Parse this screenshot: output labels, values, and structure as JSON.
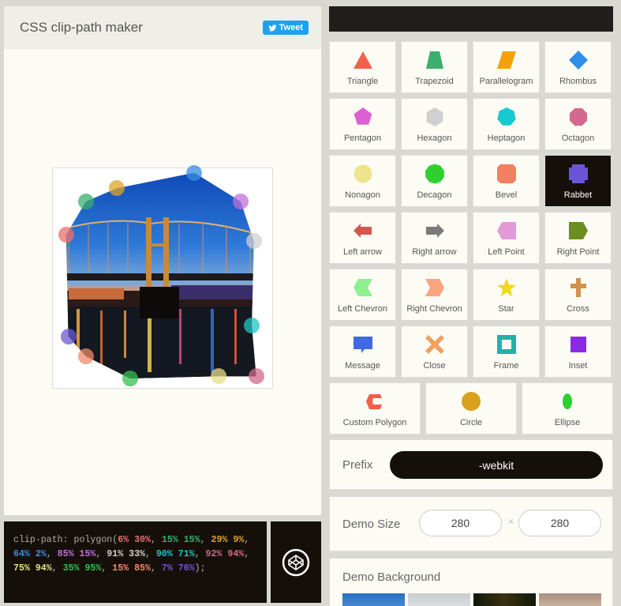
{
  "app": {
    "title": "CSS clip-path maker",
    "tweet_label": "Tweet"
  },
  "code": {
    "property": "clip-path: polygon(",
    "points": [
      {
        "text": "6% 30%",
        "color": "#e8706e"
      },
      {
        "text": "15% 15%",
        "color": "#3aaf6e"
      },
      {
        "text": "29% 9%",
        "color": "#e2a32e"
      },
      {
        "text": "64% 2%",
        "color": "#3a8ee0"
      },
      {
        "text": "85% 15%",
        "color": "#c070d8"
      },
      {
        "text": "91% 33%",
        "color": "#d0d0d0"
      },
      {
        "text": "90% 71%",
        "color": "#20c4c4"
      },
      {
        "text": "92% 94%",
        "color": "#d4688e"
      },
      {
        "text": "75% 94%",
        "color": "#e8e08a"
      },
      {
        "text": "35% 95%",
        "color": "#33c24d"
      },
      {
        "text": "15% 85%",
        "color": "#f08a6a"
      },
      {
        "text": "7% 76%",
        "color": "#6a5ad0"
      }
    ],
    "close": ");"
  },
  "shapes": [
    {
      "label": "Triangle",
      "icon": "triangle",
      "color": "#f0604a"
    },
    {
      "label": "Trapezoid",
      "icon": "trapezoid",
      "color": "#3aaf6e"
    },
    {
      "label": "Parallelogram",
      "icon": "parallelogram",
      "color": "#f5a20a"
    },
    {
      "label": "Rhombus",
      "icon": "rhombus",
      "color": "#2e8fe8"
    },
    {
      "label": "Pentagon",
      "icon": "pentagon",
      "color": "#dd5fd2"
    },
    {
      "label": "Hexagon",
      "icon": "hexagon",
      "color": "#d0d0d0"
    },
    {
      "label": "Heptagon",
      "icon": "heptagon",
      "color": "#18c9cf"
    },
    {
      "label": "Octagon",
      "icon": "octagon",
      "color": "#d4688e"
    },
    {
      "label": "Nonagon",
      "icon": "nonagon",
      "color": "#ede58c"
    },
    {
      "label": "Decagon",
      "icon": "decagon",
      "color": "#2fcf2f"
    },
    {
      "label": "Bevel",
      "icon": "bevel",
      "color": "#f0805f"
    },
    {
      "label": "Rabbet",
      "icon": "rabbet",
      "color": "#6a55d8"
    },
    {
      "label": "Left arrow",
      "icon": "left-arrow",
      "color": "#d9534f"
    },
    {
      "label": "Right arrow",
      "icon": "right-arrow",
      "color": "#7a7a7a"
    },
    {
      "label": "Left Point",
      "icon": "left-point",
      "color": "#e29ad9"
    },
    {
      "label": "Right Point",
      "icon": "right-point",
      "color": "#6b8e23"
    },
    {
      "label": "Left Chevron",
      "icon": "left-chevron",
      "color": "#8ef08e"
    },
    {
      "label": "Right Chevron",
      "icon": "right-chevron",
      "color": "#f7a47f"
    },
    {
      "label": "Star",
      "icon": "star",
      "color": "#f0d820"
    },
    {
      "label": "Cross",
      "icon": "cross",
      "color": "#d0924a"
    },
    {
      "label": "Message",
      "icon": "message",
      "color": "#4169e1"
    },
    {
      "label": "Close",
      "icon": "close",
      "color": "#f0a060"
    },
    {
      "label": "Frame",
      "icon": "frame",
      "color": "#20b2aa"
    },
    {
      "label": "Inset",
      "icon": "inset",
      "color": "#8a2be2"
    }
  ],
  "shapes_row3": [
    {
      "label": "Custom Polygon",
      "icon": "custom-polygon",
      "color": "#f0604a"
    },
    {
      "label": "Circle",
      "icon": "circle",
      "color": "#d9a21e"
    },
    {
      "label": "Ellipse",
      "icon": "ellipse",
      "color": "#2fcf2f"
    }
  ],
  "selected_shape": "Rabbet",
  "prefix": {
    "label": "Prefix",
    "value": "-webkit"
  },
  "demo_size": {
    "label": "Demo Size",
    "width": "280",
    "height": "280",
    "separator": "×"
  },
  "demo_background": {
    "label": "Demo Background"
  }
}
